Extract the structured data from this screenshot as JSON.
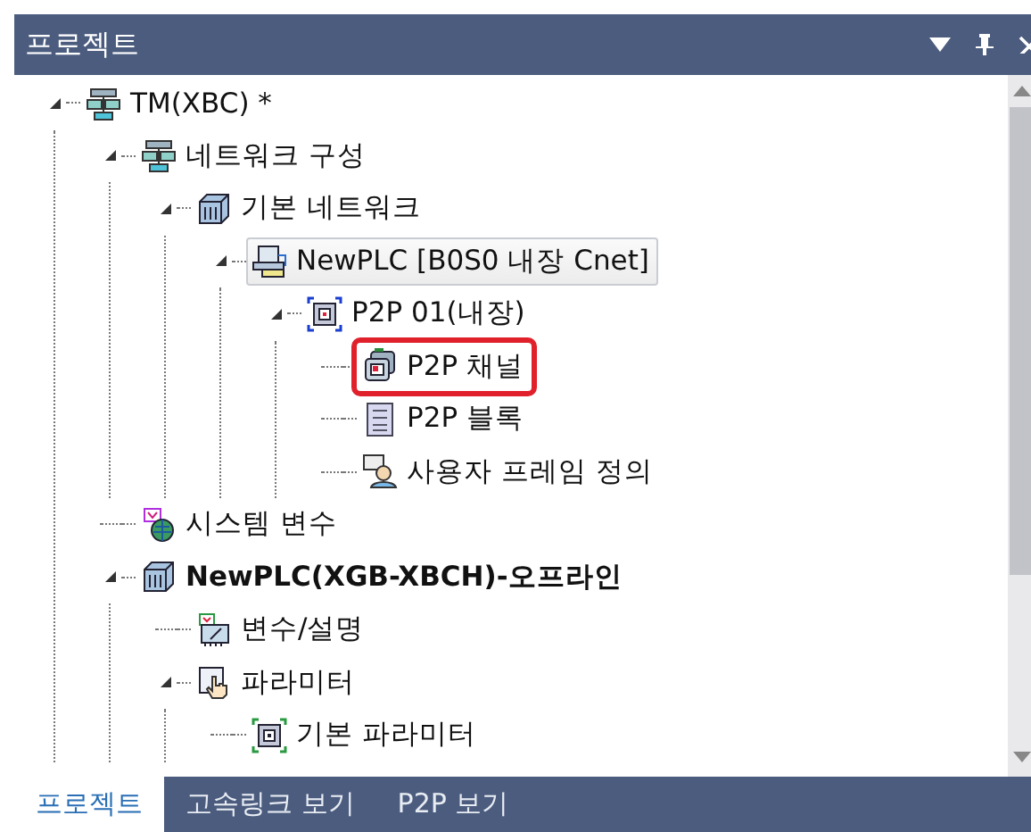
{
  "panel": {
    "title": "프로젝트"
  },
  "tree": [
    {
      "label": "TM(XBC) *",
      "expanded": true,
      "children": [
        {
          "label": "네트워크 구성",
          "expanded": true,
          "children": [
            {
              "label": "기본 네트워크",
              "expanded": true,
              "children": [
                {
                  "label": "NewPLC [B0S0 내장 Cnet]",
                  "expanded": true,
                  "selected": true,
                  "children": [
                    {
                      "label": "P2P 01(내장)",
                      "expanded": true,
                      "selected": false,
                      "children": [
                        {
                          "label": "P2P 채널",
                          "selected": false,
                          "highlighted": true
                        },
                        {
                          "label": "P2P 블록",
                          "selected": false,
                          "highlighted": false
                        },
                        {
                          "label": "사용자 프레임 정의",
                          "selected": false,
                          "highlighted": false
                        }
                      ]
                    }
                  ]
                }
              ]
            }
          ]
        },
        {
          "label": "시스템 변수",
          "active": false
        },
        {
          "label": "NewPLC(XGB-XBCH)-오프라인",
          "expanded": true,
          "active": true,
          "children": [
            {
              "label": "변수/설명"
            },
            {
              "label": "파라미터",
              "expanded": true,
              "children": [
                {
                  "label": "기본 파라미터"
                }
              ]
            }
          ]
        }
      ]
    }
  ],
  "tabs": [
    {
      "label": "프로젝트",
      "selected": true
    },
    {
      "label": "고속링크 보기",
      "selected": false
    },
    {
      "label": "P2P 보기",
      "selected": false
    }
  ]
}
